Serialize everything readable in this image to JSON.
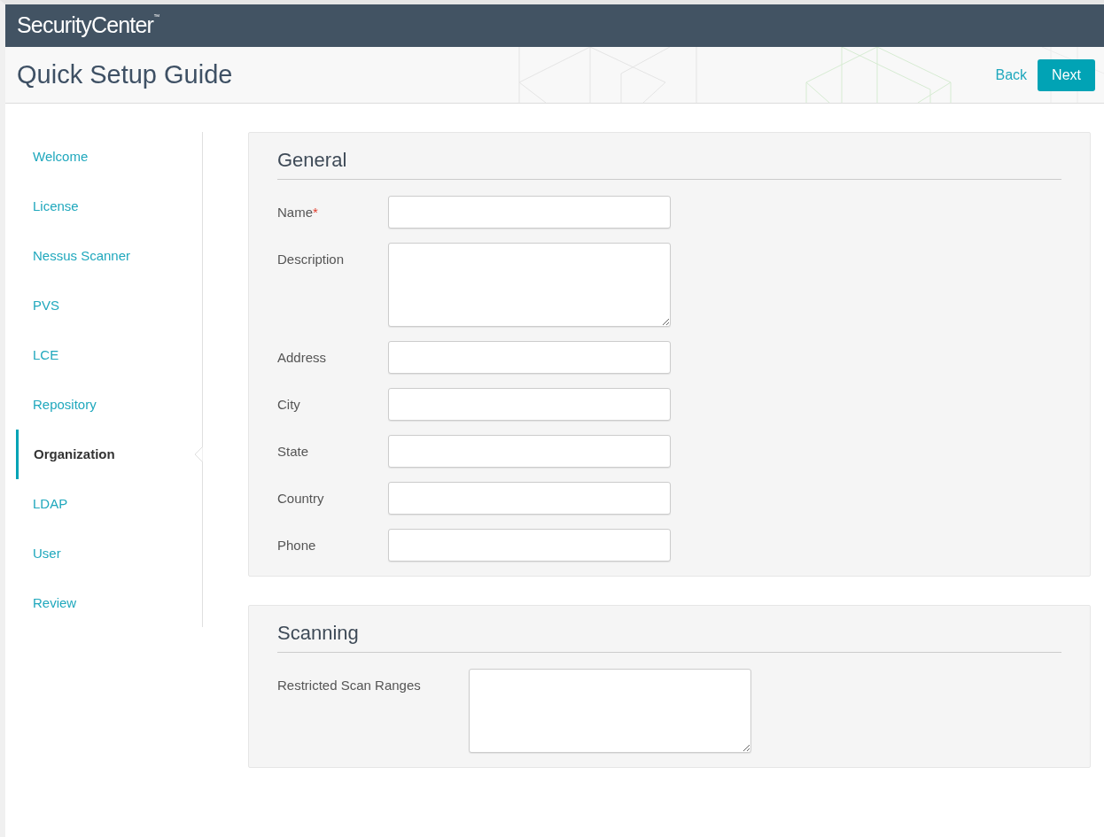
{
  "app": {
    "brand": "SecurityCenter",
    "brand_mark": "™"
  },
  "header": {
    "title": "Quick Setup Guide",
    "back": "Back",
    "next": "Next"
  },
  "steps": [
    {
      "label": "Welcome",
      "selected": false
    },
    {
      "label": "License",
      "selected": false
    },
    {
      "label": "Nessus Scanner",
      "selected": false
    },
    {
      "label": "PVS",
      "selected": false
    },
    {
      "label": "LCE",
      "selected": false
    },
    {
      "label": "Repository",
      "selected": false
    },
    {
      "label": "Organization",
      "selected": true
    },
    {
      "label": "LDAP",
      "selected": false
    },
    {
      "label": "User",
      "selected": false
    },
    {
      "label": "Review",
      "selected": false
    }
  ],
  "sections": [
    {
      "title": "General",
      "fields": [
        {
          "label": "Name",
          "required_mark": "*",
          "kind": "input"
        },
        {
          "label": "Description",
          "kind": "textarea"
        },
        {
          "label": "Address",
          "kind": "input"
        },
        {
          "label": "City",
          "kind": "input"
        },
        {
          "label": "State",
          "kind": "input"
        },
        {
          "label": "Country",
          "kind": "input"
        },
        {
          "label": "Phone",
          "kind": "input"
        }
      ]
    },
    {
      "title": "Scanning",
      "wide_labels": true,
      "fields": [
        {
          "label": "Restricted Scan Ranges",
          "kind": "textarea"
        }
      ]
    }
  ]
}
